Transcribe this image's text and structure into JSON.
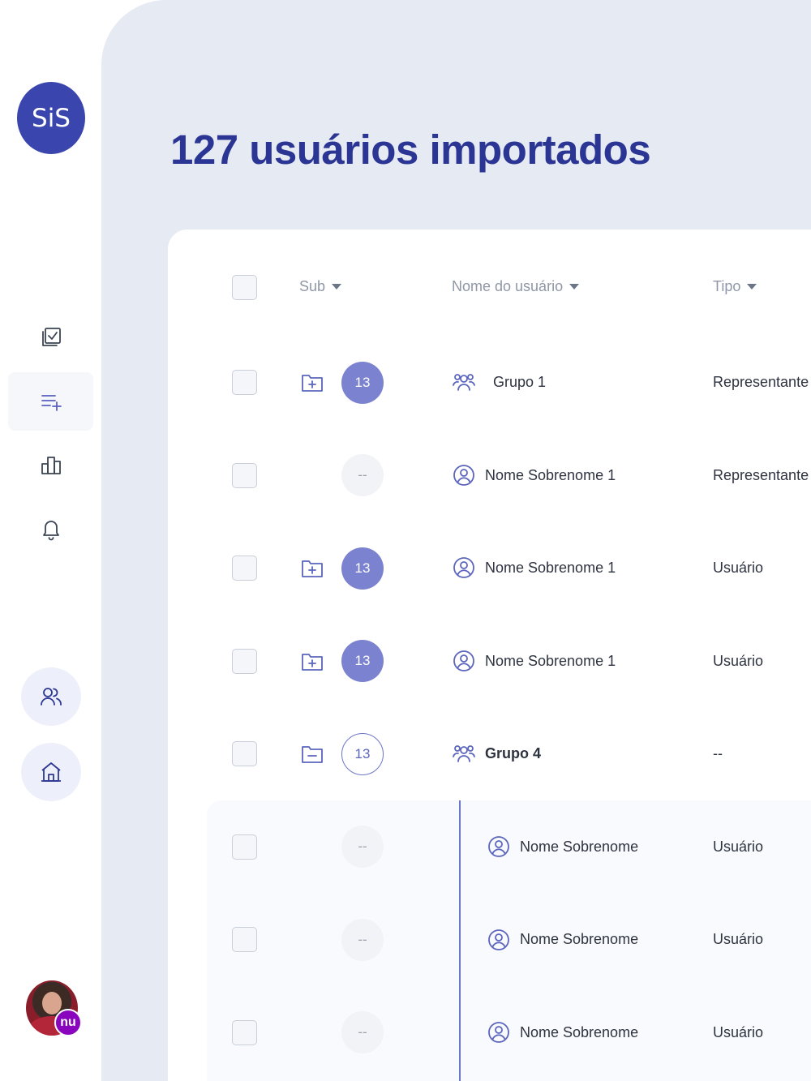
{
  "sidebar": {
    "logo_text": "SiS",
    "nav_items": [
      {
        "icon": "checklist-icon"
      },
      {
        "icon": "add-list-icon",
        "active": true
      },
      {
        "icon": "bar-chart-icon"
      },
      {
        "icon": "bell-icon"
      }
    ],
    "round_buttons": [
      {
        "icon": "users-icon"
      },
      {
        "icon": "home-icon"
      }
    ],
    "profile_badge": "nu"
  },
  "header": {
    "title": "127 usuários importados"
  },
  "table": {
    "columns": [
      "Sub",
      "Nome do usuário",
      "Tipo"
    ],
    "rows": [
      {
        "sub_folder": "folder-plus-icon",
        "count": "13",
        "count_style": "filled",
        "user_icon": "group-icon",
        "name": "Grupo 1",
        "type": "Representante"
      },
      {
        "sub_folder": "",
        "count": "--",
        "count_style": "empty",
        "user_icon": "user-circle-icon",
        "name": "Nome Sobrenome 1",
        "type": "Representante"
      },
      {
        "sub_folder": "folder-plus-icon",
        "count": "13",
        "count_style": "filled",
        "user_icon": "user-circle-icon",
        "name": "Nome Sobrenome 1",
        "type": "Usuário"
      },
      {
        "sub_folder": "folder-plus-icon",
        "count": "13",
        "count_style": "filled",
        "user_icon": "user-circle-icon",
        "name": "Nome Sobrenome 1",
        "type": "Usuário"
      },
      {
        "sub_folder": "folder-minus-icon",
        "count": "13",
        "count_style": "outline",
        "user_icon": "group-icon",
        "name": "Grupo 4",
        "type": "--",
        "bold": true
      },
      {
        "sub_folder": "",
        "count": "--",
        "count_style": "empty",
        "user_icon": "user-circle-icon",
        "name": "Nome Sobrenome",
        "type": "Usuário",
        "nested": true
      },
      {
        "sub_folder": "",
        "count": "--",
        "count_style": "empty",
        "user_icon": "user-circle-icon",
        "name": "Nome Sobrenome",
        "type": "Usuário",
        "nested": true
      },
      {
        "sub_folder": "",
        "count": "--",
        "count_style": "empty",
        "user_icon": "user-circle-icon",
        "name": "Nome Sobrenome",
        "type": "Usuário",
        "nested": true
      }
    ]
  },
  "colors": {
    "brand": "#3a46ad",
    "title": "#2b3594",
    "accent": "#7b82d0",
    "badge": "#8a05be"
  }
}
